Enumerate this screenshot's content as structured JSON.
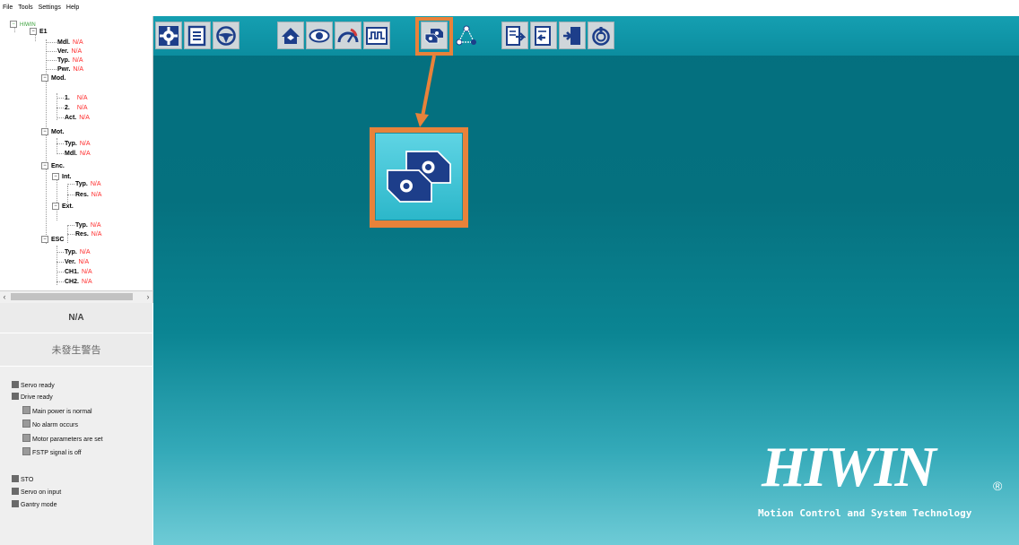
{
  "menu": [
    "File",
    "Tools",
    "Settings",
    "Help"
  ],
  "tree": {
    "root": "HIWIN",
    "device": "E1",
    "na": "N/A",
    "items": [
      {
        "label": "Mdl."
      },
      {
        "label": "Ver."
      },
      {
        "label": "Typ."
      },
      {
        "label": "Pwr."
      },
      {
        "label": "Mod."
      },
      {
        "label": "1."
      },
      {
        "label": "2."
      },
      {
        "label": "Act."
      },
      {
        "label": "Mot."
      },
      {
        "label": "Typ."
      },
      {
        "label": "Mdl."
      },
      {
        "label": "Enc."
      },
      {
        "label": "Int."
      },
      {
        "label": "Typ."
      },
      {
        "label": "Res."
      },
      {
        "label": "Ext."
      },
      {
        "label": "Typ."
      },
      {
        "label": "Res."
      },
      {
        "label": "ESC"
      },
      {
        "label": "Typ."
      },
      {
        "label": "Ver."
      },
      {
        "label": "CH1."
      },
      {
        "label": "CH2."
      }
    ]
  },
  "status_value": "N/A",
  "warning_text": "未發生警告",
  "status_list": [
    {
      "label": "Servo ready"
    },
    {
      "label": "Drive ready"
    },
    {
      "label": "Main power is normal"
    },
    {
      "label": "No alarm occurs"
    },
    {
      "label": "Motor parameters are set"
    },
    {
      "label": "FSTP signal is off"
    },
    {
      "label": "STO"
    },
    {
      "label": "Servo on input"
    },
    {
      "label": "Gantry mode"
    }
  ],
  "toolbar_icons": [
    "config-wizard-icon",
    "parameter-list-icon",
    "steering-wheel-icon",
    "home-icon",
    "monitor-eye-icon",
    "gauge-icon",
    "scope-wave-icon",
    "gantry-blocks-icon",
    "point-to-point-icon",
    "export-icon",
    "import-icon",
    "firmware-icon",
    "power-reset-icon"
  ],
  "highlight_color": "#e8823a",
  "brand": {
    "name": "HIWIN",
    "registered": "®",
    "tagline": "Motion Control and System Technology"
  }
}
